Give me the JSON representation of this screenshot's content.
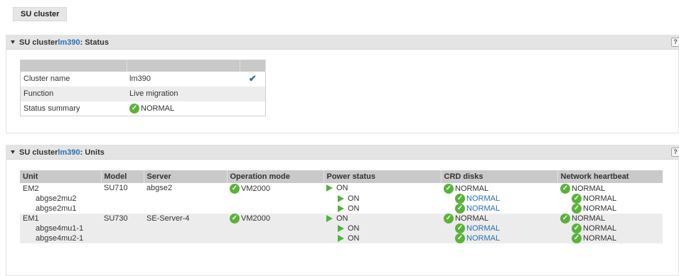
{
  "top_tab": {
    "label": "SU cluster"
  },
  "status_panel": {
    "title_prefix": "SU cluster ",
    "cluster_link": "lm390",
    "title_suffix": ": Status",
    "help": "?",
    "rows": {
      "cluster_name_label": "Cluster name",
      "cluster_name_value": "lm390",
      "function_label": "Function",
      "function_value": "Live migration",
      "status_summary_label": "Status summary",
      "status_summary_value": "NORMAL"
    }
  },
  "units_panel": {
    "title_prefix": "SU cluster ",
    "cluster_link": "lm390",
    "title_suffix": ": Units",
    "help": "?",
    "headers": {
      "unit": "Unit",
      "model": "Model",
      "server": "Server",
      "operation_mode": "Operation mode",
      "power_status": "Power status",
      "crd_disks": "CRD disks",
      "network_heartbeat": "Network heartbeat"
    },
    "groups": [
      {
        "unit": "EM2",
        "model": "SU710",
        "server": "abgse2",
        "operation_mode": "VM2000",
        "power": "ON",
        "crd": "NORMAL",
        "heartbeat": "NORMAL",
        "subs": [
          {
            "unit": "abgse2mu2",
            "power": "ON",
            "crd": "NORMAL",
            "heartbeat": "NORMAL"
          },
          {
            "unit": "abgse2mu1",
            "power": "ON",
            "crd": "NORMAL",
            "heartbeat": "NORMAL"
          }
        ]
      },
      {
        "unit": "EM1",
        "model": "SU730",
        "server": "SE-Server-4",
        "operation_mode": "VM2000",
        "power": "ON",
        "crd": "NORMAL",
        "heartbeat": "NORMAL",
        "subs": [
          {
            "unit": "abgse4mu1-1",
            "power": "ON",
            "crd": "NORMAL",
            "heartbeat": "NORMAL"
          },
          {
            "unit": "abgse4mu2-1",
            "power": "ON",
            "crd": "NORMAL",
            "heartbeat": "NORMAL"
          }
        ]
      }
    ]
  },
  "colors": {
    "ok_green": "#59b33a",
    "link_blue": "#2a6fb5",
    "header_gray": "#c9c9c9"
  },
  "icons": {
    "ok": "ok-check-circle-icon",
    "power": "play-triangle-icon",
    "collapse": "collapse-triangle-icon",
    "check": "checkmark-icon",
    "help": "help-icon"
  }
}
